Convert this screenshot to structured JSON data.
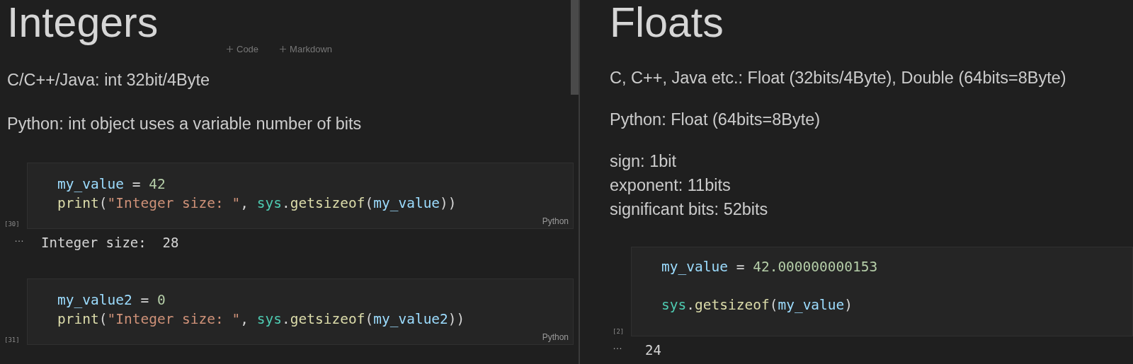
{
  "panels": [
    {
      "title": "Integers",
      "cell_toolbar": [
        {
          "label": "Code"
        },
        {
          "label": "Markdown"
        }
      ],
      "paragraphs": [
        [
          "C/C++/Java: int 32bit/4Byte"
        ],
        [
          "Python: int object uses a variable number of bits"
        ]
      ],
      "cells": [
        {
          "count": "[30]",
          "language": "Python",
          "lines": [
            {
              "tokens": [
                {
                  "kind": "var",
                  "text": "my_value"
                },
                {
                  "kind": "op",
                  "text": " = "
                },
                {
                  "kind": "num",
                  "text": "42"
                }
              ]
            },
            {
              "tokens": [
                {
                  "kind": "func",
                  "text": "print"
                },
                {
                  "kind": "op",
                  "text": "("
                },
                {
                  "kind": "str",
                  "text": "\"Integer size: \""
                },
                {
                  "kind": "op",
                  "text": ", "
                },
                {
                  "kind": "module",
                  "text": "sys"
                },
                {
                  "kind": "op",
                  "text": "."
                },
                {
                  "kind": "func",
                  "text": "getsizeof"
                },
                {
                  "kind": "op",
                  "text": "("
                },
                {
                  "kind": "var",
                  "text": "my_value"
                },
                {
                  "kind": "op",
                  "text": "))"
                }
              ]
            }
          ],
          "output_marker": "…",
          "output": "Integer size:  28"
        },
        {
          "count": "[31]",
          "language": "Python",
          "lines": [
            {
              "tokens": [
                {
                  "kind": "var",
                  "text": "my_value2"
                },
                {
                  "kind": "op",
                  "text": " = "
                },
                {
                  "kind": "num",
                  "text": "0"
                }
              ]
            },
            {
              "tokens": [
                {
                  "kind": "func",
                  "text": "print"
                },
                {
                  "kind": "op",
                  "text": "("
                },
                {
                  "kind": "str",
                  "text": "\"Integer size: \""
                },
                {
                  "kind": "op",
                  "text": ", "
                },
                {
                  "kind": "module",
                  "text": "sys"
                },
                {
                  "kind": "op",
                  "text": "."
                },
                {
                  "kind": "func",
                  "text": "getsizeof"
                },
                {
                  "kind": "op",
                  "text": "("
                },
                {
                  "kind": "var",
                  "text": "my_value2"
                },
                {
                  "kind": "op",
                  "text": "))"
                }
              ]
            }
          ]
        }
      ]
    },
    {
      "title": "Floats",
      "paragraphs": [
        [
          "C, C++, Java etc.: Float (32bits/4Byte), Double (64bits=8Byte)"
        ],
        [
          "Python: Float (64bits=8Byte)"
        ],
        [
          "sign: 1bit",
          "exponent: 11bits",
          "significant bits: 52bits"
        ]
      ],
      "cells": [
        {
          "count": "[2]",
          "lines": [
            {
              "tokens": [
                {
                  "kind": "var",
                  "text": "my_value"
                },
                {
                  "kind": "op",
                  "text": " = "
                },
                {
                  "kind": "num",
                  "text": "42.000000000153"
                }
              ]
            },
            {
              "blank_line_before": true,
              "tokens": [
                {
                  "kind": "module",
                  "text": "sys"
                },
                {
                  "kind": "op",
                  "text": "."
                },
                {
                  "kind": "func",
                  "text": "getsizeof"
                },
                {
                  "kind": "op",
                  "text": "("
                },
                {
                  "kind": "var",
                  "text": "my_value"
                },
                {
                  "kind": "op",
                  "text": ")"
                }
              ]
            }
          ],
          "output_marker": "…",
          "output": "24"
        }
      ]
    }
  ]
}
